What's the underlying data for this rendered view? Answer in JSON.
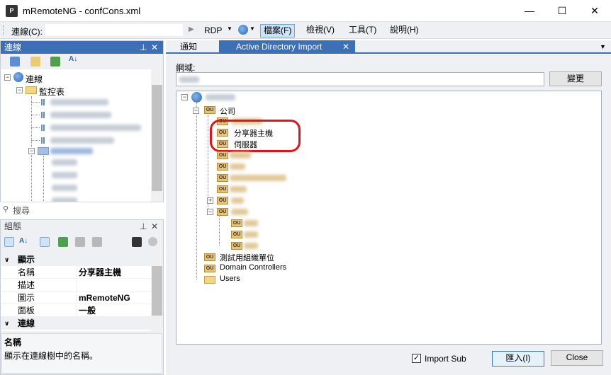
{
  "window": {
    "title": "mRemoteNG - confCons.xml",
    "minimize": "—",
    "maximize": "☐",
    "close": "✕"
  },
  "toolbar": {
    "connect_label": "連線(C):",
    "rdp_label": "RDP",
    "menus": [
      "檔案(F)",
      "檢視(V)",
      "工具(T)",
      "說明(H)"
    ]
  },
  "connections": {
    "title": "連線",
    "pin": "ꟷ",
    "close": "✕",
    "tree": {
      "root": "連線",
      "folder": "監控表"
    },
    "search_placeholder": "搜尋"
  },
  "properties": {
    "title": "組態",
    "rows": [
      {
        "kind": "category",
        "name": "顯示"
      },
      {
        "kind": "prop",
        "name": "名稱",
        "value": "分享器主機"
      },
      {
        "kind": "prop",
        "name": "描述",
        "value": ""
      },
      {
        "kind": "prop",
        "name": "圖示",
        "value": "mRemoteNG"
      },
      {
        "kind": "prop",
        "name": "面板",
        "value": "一般"
      },
      {
        "kind": "category",
        "name": "連線"
      }
    ],
    "desc_title": "名稱",
    "desc_text": "顯示在連線樹中的名稱。"
  },
  "tabs": {
    "notify": "通知",
    "ad": "Active Directory Import",
    "close": "✕"
  },
  "ad_import": {
    "domain_label": "網域:",
    "change_button": "變更",
    "tree": {
      "company": "公司",
      "share_host": "分享器主機",
      "server": "伺服器",
      "test_ou": "測試用組織單位",
      "domain_controllers": "Domain Controllers",
      "users": "Users"
    },
    "import_sub_label": "Import Sub",
    "import_sub_checked": true,
    "import_button": "匯入(I)",
    "close_button": "Close"
  }
}
